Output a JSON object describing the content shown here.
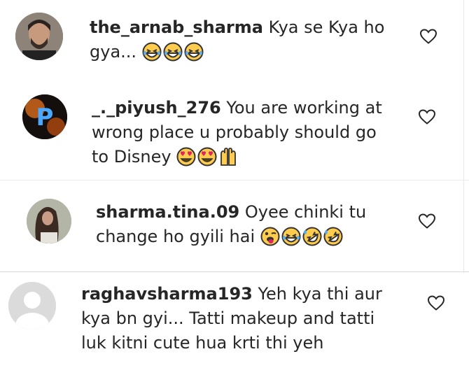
{
  "comments": [
    {
      "username": "the_arnab_sharma",
      "text_line1": "Kya se Kya ho",
      "text_line2": "gya...",
      "emojis": [
        "laugh-emoji",
        "laugh-emoji",
        "laugh-emoji"
      ],
      "liked": false
    },
    {
      "username": "_._piyush_276",
      "text_line1": "You are working at",
      "text_line2": "wrong place u probably should go",
      "text_line3": "to Disney",
      "emojis": [
        "heart-eyes-emoji",
        "heart-eyes-emoji",
        "raised-hands-emoji"
      ],
      "liked": false
    },
    {
      "username": "sharma.tina.09",
      "text_line1": "Oyee chinki tu",
      "text_line2": "change ho gyili hai",
      "emojis": [
        "wink-tongue-emoji",
        "laugh-emoji",
        "rofl-emoji",
        "rofl-emoji"
      ],
      "liked": false
    },
    {
      "username": "raghavsharma193",
      "text_line1": "Yeh kya thi aur",
      "text_line2": "kya bn gyi... Tatti makeup and tatti",
      "text_line3": "luk kitni cute hua krti thi yeh",
      "emojis": [],
      "liked": false
    }
  ],
  "colors": {
    "text": "#262626",
    "emoji_face": "#ffcc4d",
    "emoji_outline": "#333333",
    "heart_stroke": "#262626",
    "divider": "#dbdbdb"
  }
}
